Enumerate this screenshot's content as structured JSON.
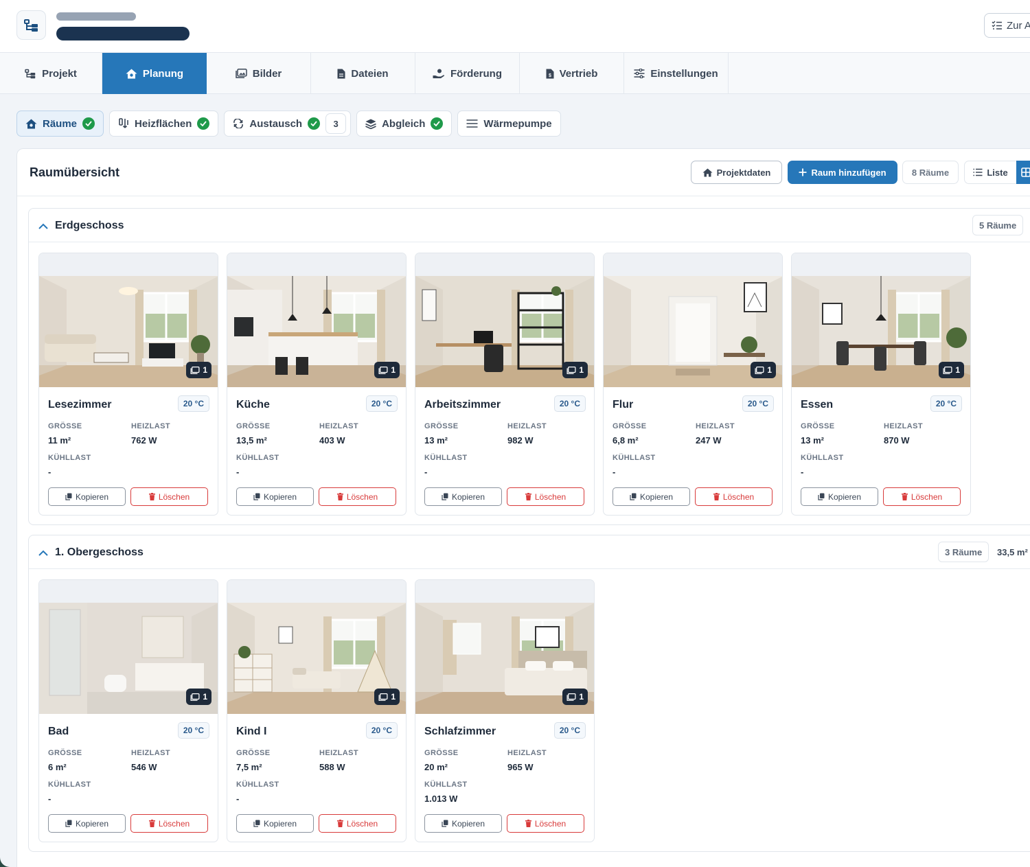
{
  "header": {
    "back_label": "Zur A"
  },
  "nav": {
    "tabs": [
      {
        "label": "Projekt",
        "icon": "project-tree-icon",
        "active": false
      },
      {
        "label": "Planung",
        "icon": "house-gear-icon",
        "active": true
      },
      {
        "label": "Bilder",
        "icon": "images-icon",
        "active": false
      },
      {
        "label": "Dateien",
        "icon": "file-icon",
        "active": false
      },
      {
        "label": "Förderung",
        "icon": "hand-coin-icon",
        "active": false
      },
      {
        "label": "Vertrieb",
        "icon": "file-invoice-icon",
        "active": false
      },
      {
        "label": "Einstellungen",
        "icon": "sliders-icon",
        "active": false
      }
    ]
  },
  "subtabs": [
    {
      "label": "Räume",
      "done": true
    },
    {
      "label": "Heizflächen",
      "done": true
    },
    {
      "label": "Austausch",
      "done": true,
      "count": "3"
    },
    {
      "label": "Abgleich",
      "done": true
    },
    {
      "label": "Wärmepumpe",
      "done": false
    }
  ],
  "panel": {
    "title": "Raumübersicht",
    "projektdaten_label": "Projektdaten",
    "add_room_label": "Raum hinzufügen",
    "room_count_label": "8 Räume",
    "list_view_label": "Liste"
  },
  "labels": {
    "size": "GRÖSSE",
    "heat_load": "HEIZLAST",
    "cool_load": "KÜHLLAST",
    "copy": "Kopieren",
    "delete": "Löschen"
  },
  "floors": [
    {
      "name": "Erdgeschoss",
      "room_count": "5 Räume",
      "rooms": [
        {
          "name": "Lesezimmer",
          "temp": "20 °C",
          "size": "11 m²",
          "heat": "762 W",
          "cool": "-",
          "images": "1"
        },
        {
          "name": "Küche",
          "temp": "20 °C",
          "size": "13,5 m²",
          "heat": "403 W",
          "cool": "-",
          "images": "1"
        },
        {
          "name": "Arbeitszimmer",
          "temp": "20 °C",
          "size": "13 m²",
          "heat": "982 W",
          "cool": "-",
          "images": "1"
        },
        {
          "name": "Flur",
          "temp": "20 °C",
          "size": "6,8 m²",
          "heat": "247 W",
          "cool": "-",
          "images": "1"
        },
        {
          "name": "Essen",
          "temp": "20 °C",
          "size": "13 m²",
          "heat": "870 W",
          "cool": "-",
          "images": "1"
        }
      ]
    },
    {
      "name": "1. Obergeschoss",
      "room_count": "3 Räume",
      "area": "33,5 m²",
      "rooms": [
        {
          "name": "Bad",
          "temp": "20 °C",
          "size": "6 m²",
          "heat": "546 W",
          "cool": "-",
          "images": "1"
        },
        {
          "name": "Kind I",
          "temp": "20 °C",
          "size": "7,5 m²",
          "heat": "588 W",
          "cool": "-",
          "images": "1"
        },
        {
          "name": "Schlafzimmer",
          "temp": "20 °C",
          "size": "20 m²",
          "heat": "965 W",
          "cool": "1.013 W",
          "images": "1"
        }
      ]
    }
  ],
  "colors": {
    "primary": "#2677b9",
    "success": "#1f9a4a",
    "danger": "#d83a3a",
    "dark": "#1b3350"
  }
}
